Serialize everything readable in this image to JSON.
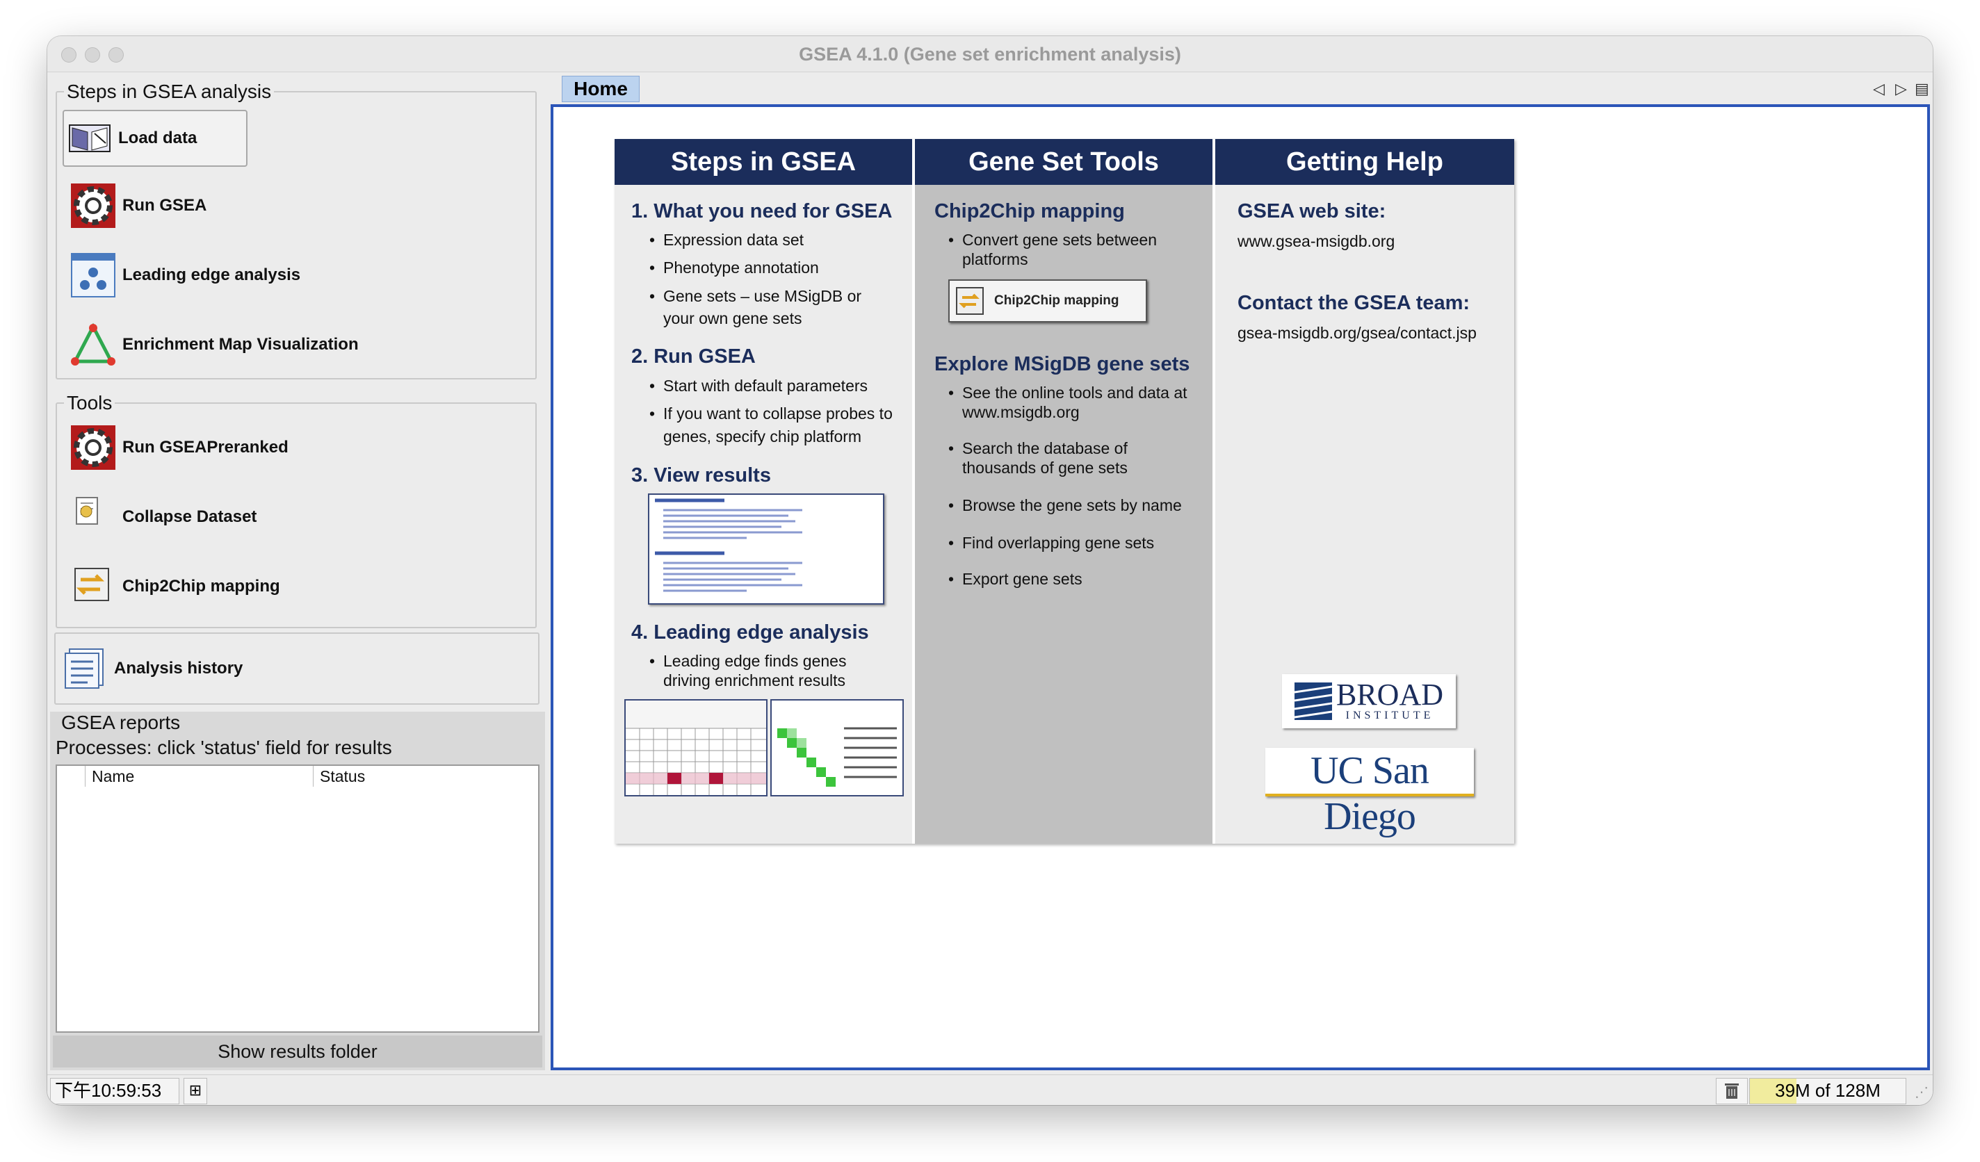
{
  "window": {
    "title": "GSEA 4.1.0 (Gene set enrichment analysis)"
  },
  "steps_panel": {
    "title": "Steps in GSEA analysis",
    "items": [
      {
        "label": "Load data",
        "icon": "book-icon"
      },
      {
        "label": "Run GSEA",
        "icon": "gear-icon"
      },
      {
        "label": "Leading edge analysis",
        "icon": "leading-edge-icon"
      },
      {
        "label": "Enrichment Map Visualization",
        "icon": "triangle-network-icon"
      }
    ]
  },
  "tools_panel": {
    "title": "Tools",
    "items": [
      {
        "label": "Run GSEAPreranked",
        "icon": "gear-icon"
      },
      {
        "label": "Collapse Dataset",
        "icon": "collapse-icon"
      },
      {
        "label": "Chip2Chip mapping",
        "icon": "chip2chip-icon"
      }
    ]
  },
  "history": {
    "label": "Analysis history",
    "icon": "history-icon"
  },
  "reports": {
    "title": "GSEA reports",
    "subtitle": "Processes: click 'status' field for results",
    "columns": [
      "Name",
      "Status"
    ],
    "button": "Show results folder"
  },
  "tabs": [
    {
      "label": "Home"
    }
  ],
  "home": {
    "col1": {
      "header": "Steps in GSEA",
      "s1": {
        "title": "1. What you need for GSEA",
        "bullets": [
          "Expression data set",
          "Phenotype annotation",
          "Gene sets – use MSigDB or",
          "your own gene sets"
        ]
      },
      "s2": {
        "title": "2. Run GSEA",
        "bullets": [
          "Start with default parameters",
          "If you want to collapse probes to",
          "genes, specify chip platform"
        ]
      },
      "s3": {
        "title": "3. View results"
      },
      "s4": {
        "title": "4. Leading edge analysis",
        "bullets": [
          "Leading edge finds genes",
          "driving enrichment results"
        ]
      }
    },
    "col2": {
      "header": "Gene Set Tools",
      "s1": {
        "title": "Chip2Chip mapping",
        "bullets": [
          "Convert gene sets between",
          "platforms"
        ],
        "button": "Chip2Chip mapping"
      },
      "s2": {
        "title": "Explore MSigDB gene sets",
        "bullets": [
          "See the online tools and data at",
          "www.msigdb.org",
          "Search the database of",
          "thousands of gene sets",
          "Browse the gene sets by name",
          "Find overlapping gene sets",
          "Export gene sets"
        ]
      }
    },
    "col3": {
      "header": "Getting Help",
      "web_title": "GSEA web site:",
      "web": "www.gsea-msigdb.org",
      "contact_title": "Contact the GSEA team:",
      "contact": "gsea-msigdb.org/gsea/contact.jsp",
      "logo1": "BROAD",
      "logo1_sub": "INSTITUTE",
      "logo2": "UC San Diego"
    }
  },
  "status": {
    "time": "下午10:59:53",
    "memory": "39M of 128M",
    "memory_used_fraction": 0.3
  },
  "colors": {
    "navy": "#1b2d5b",
    "tab_blue": "#bcd3ef",
    "content_border": "#2b55b8"
  }
}
